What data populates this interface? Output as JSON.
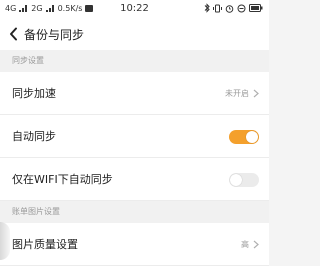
{
  "status_bar": {
    "network_1": "4G",
    "network_2": "2G",
    "speed": "0.5K/s",
    "time": "10:22"
  },
  "header": {
    "title": "备份与同步"
  },
  "sections": [
    {
      "title": "同步设置"
    },
    {
      "title": "账单图片设置"
    }
  ],
  "rows": {
    "sync_accelerate": {
      "label": "同步加速",
      "value": "未开启"
    },
    "auto_sync": {
      "label": "自动同步",
      "toggle": true
    },
    "wifi_only_sync": {
      "label": "仅在WIFI下自动同步",
      "toggle": false
    },
    "image_quality": {
      "label": "图片质量设置",
      "value": "高"
    }
  },
  "colors": {
    "accent": "#f4a02c"
  },
  "icons": [
    "back-arrow-icon",
    "chevron-right-icon",
    "bluetooth-icon",
    "alarm-icon",
    "battery-icon"
  ]
}
